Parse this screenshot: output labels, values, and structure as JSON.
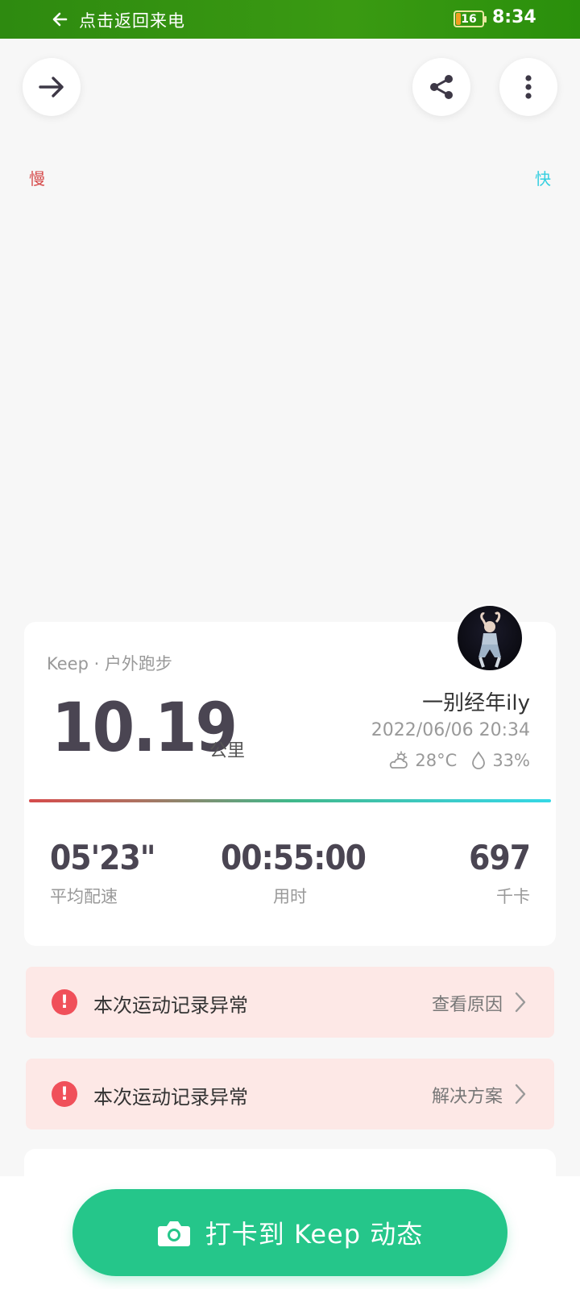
{
  "status_bar": {
    "back_label": "点击返回来电",
    "battery_level": "16",
    "time": "8:34"
  },
  "header": {
    "back_icon": "arrow-right-icon",
    "share_icon": "share-icon",
    "more_icon": "more-vertical-icon"
  },
  "summary": {
    "source": "Keep · 户外跑步",
    "distance": "10.19",
    "distance_unit": "公里",
    "user_name": "一别经年ily",
    "datetime": "2022/06/06 20:34",
    "temperature": "28°C",
    "humidity": "33%",
    "pace_slow_label": "慢",
    "pace_fast_label": "快",
    "stats": [
      {
        "value": "05'23\"",
        "label": "平均配速"
      },
      {
        "value": "00:55:00",
        "label": "用时"
      },
      {
        "value": "697",
        "label": "千卡"
      }
    ]
  },
  "warnings": [
    {
      "text": "本次运动记录异常",
      "action": "查看原因"
    },
    {
      "text": "本次运动记录异常",
      "action": "解决方案"
    }
  ],
  "checkin": {
    "label": "打卡到 Keep 动态"
  },
  "colors": {
    "accent": "#25c68a",
    "status_bar": "#2e8a10",
    "warning_bg": "#fde8e6",
    "warning_icon": "#f0505a",
    "slow": "#d64b4b",
    "fast": "#35d8e6"
  }
}
